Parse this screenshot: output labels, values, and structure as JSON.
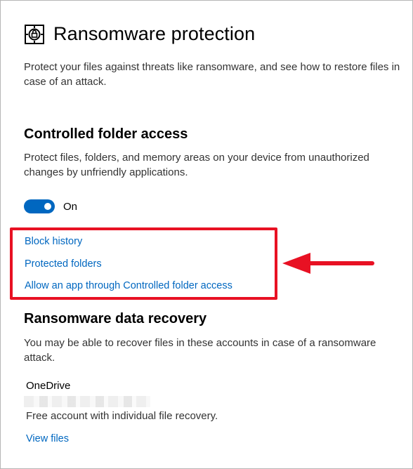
{
  "page": {
    "title": "Ransomware protection",
    "icon": "ransomware-shield-icon",
    "intro": "Protect your files against threats like ransomware, and see how to restore files in case of an attack."
  },
  "controlled_folder_access": {
    "heading": "Controlled folder access",
    "description": "Protect files, folders, and memory areas on your device from unauthorized changes by unfriendly applications.",
    "toggle_state": "On",
    "toggle_on": true,
    "links": [
      "Block history",
      "Protected folders",
      "Allow an app through Controlled folder access"
    ]
  },
  "data_recovery": {
    "heading": "Ransomware data recovery",
    "description": "You may be able to recover files in these accounts in case of a ransomware attack.",
    "account_name": "OneDrive",
    "account_description": "Free account with individual file recovery.",
    "view_files_label": "View files"
  },
  "colors": {
    "accent": "#0067c0",
    "highlight": "#e81123",
    "text": "#000000",
    "secondary_text": "#333333"
  }
}
